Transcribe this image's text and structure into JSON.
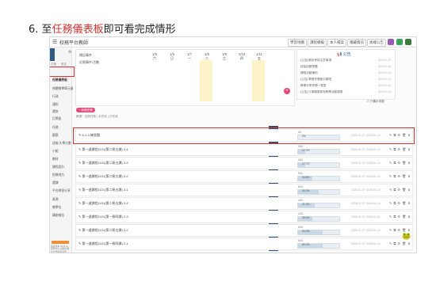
{
  "heading": {
    "number": "6.",
    "pre": "至",
    "highlight": "任務儀表板",
    "post": "即可看完成情形"
  },
  "app": {
    "title": "校務平台教師",
    "menu_icon": "menu-icon"
  },
  "toolbar": {
    "buttons": [
      "學習地圖",
      "課程模擬",
      "本人檔案",
      "隱藏資訊",
      "後端公告"
    ],
    "square_colors": [
      "#9b59b6",
      "#3aa55b",
      "#3b7a3b"
    ]
  },
  "sidebar": {
    "labels_small": [
      "切換",
      "設定"
    ],
    "items": [
      {
        "label": "任務儀表板",
        "active": true
      },
      {
        "label": "視聽教學單元量",
        "active": false
      },
      {
        "label": "行政",
        "active": false
      },
      {
        "label": "通知",
        "active": false
      },
      {
        "label": "選修",
        "active": false
      },
      {
        "label": "訂閱區",
        "active": false
      },
      {
        "label": "任務",
        "active": false
      },
      {
        "label": "觀察",
        "active": false
      },
      {
        "label": "班級/大學分數",
        "active": false
      },
      {
        "label": "小組",
        "active": false
      },
      {
        "label": "教材",
        "active": false
      },
      {
        "label": "課程設計",
        "active": false
      },
      {
        "label": "投稿地方",
        "active": false
      },
      {
        "label": "選課",
        "active": false
      },
      {
        "label": "平台問答分享",
        "active": false
      },
      {
        "label": "資源",
        "active": false
      },
      {
        "label": "教學包",
        "active": false
      },
      {
        "label": "講座報告",
        "active": false
      }
    ],
    "footer": "系統版本 2024.11 資料中心 客服信箱請洽學校資訊組"
  },
  "calendar": {
    "label_left": "標記事件",
    "label_sub": "近期事件/活動",
    "columns": [
      {
        "date": "1/5",
        "day": "六"
      },
      {
        "date": "1/6",
        "day": "日"
      },
      {
        "date": "1/7",
        "day": "一"
      },
      {
        "date": "1/8",
        "day": "二"
      },
      {
        "date": "1/9",
        "day": "三"
      },
      {
        "date": "1/10",
        "day": "四"
      },
      {
        "date": "1/11",
        "day": "五"
      }
    ]
  },
  "announcements": {
    "title": "公告",
    "rows": [
      {
        "text": "[公告] 期末考試注意事項",
        "date": "2024-12-27"
      },
      {
        "text": "評量回饋提醒",
        "date": "2024-12-26"
      },
      {
        "text": "課程活動通知",
        "date": "2024-12-25"
      },
      {
        "text": "[公告] 寒假作業繳交期限",
        "date": "2024-12-21"
      },
      {
        "text": "教學分享資源一覽表",
        "date": "2024-12-20"
      },
      {
        "text": "[公告] 行事曆更新與教學活動調整",
        "date": "2024-12-19"
      }
    ],
    "checkbox": "只顯示未讀"
  },
  "actions": {
    "add_task": "+ 新增任務",
    "filter": "篩選：全部任務 | 未完成 | 已完成"
  },
  "tasks": [
    {
      "title": "6-1-3 練習題",
      "progress_label": "0/1",
      "progress": 0,
      "progress_text": "0%",
      "date": "2025-01-07~2025-01-14",
      "highlight": true
    },
    {
      "title": "第一週課程1101(第二冊五課) 3-4",
      "progress_label": "3/10",
      "progress": 0.172,
      "progress_text": "17.2%",
      "date": "2025-01-07~2025-01-14",
      "highlight": false
    },
    {
      "title": "第一週課程1101(第二冊五課) 3-3",
      "progress_label": "3/10",
      "progress": 0.172,
      "progress_text": "17.2%",
      "date": "2025-01-07~2025-01-14",
      "highlight": false
    },
    {
      "title": "第一週課程1101(第二冊五課) 3-2",
      "progress_label": "5/10",
      "progress": 0.345,
      "progress_text": "34.5%",
      "date": "2025-01-07~2025-01-14",
      "highlight": false
    },
    {
      "title": "第一週課程1101(第二冊五課) 3-1",
      "progress_label": "6/10",
      "progress": 0.5,
      "progress_text": "50.0%",
      "date": "2025-01-07~2025-01-14",
      "highlight": false
    },
    {
      "title": "第一週課程1101(第二冊五課) 2-4",
      "progress_label": "4/10",
      "progress": 0.41,
      "progress_text": "41.0%",
      "date": "2025-01-07~2025-01-14",
      "highlight": false
    },
    {
      "title": "第一週課程1101(第一冊四課) 2-3",
      "progress_label": "4/10",
      "progress": 0.35,
      "progress_text": "35.0%",
      "date": "2025-01-07~2025-01-14",
      "highlight": false
    },
    {
      "title": "第一週課程1101(第二冊五課) 2-2",
      "progress_label": "6/10",
      "progress": 0.6,
      "progress_text": "60.0%",
      "date": "2025-01-07~2025-01-14",
      "highlight": false
    },
    {
      "title": "第一週課程1101(第一冊四課) 2-1",
      "progress_label": "6/10",
      "progress": 0.6,
      "progress_text": "60.0%",
      "date": "2025-01-07~2025-01-14",
      "highlight": false
    }
  ],
  "task_icons": "✎ ⧉ ⚙ 🗑 ⬇",
  "colors": {
    "highlight_red": "#e0302b",
    "accent_blue": "#2b5276",
    "pink": "#e0477a"
  }
}
